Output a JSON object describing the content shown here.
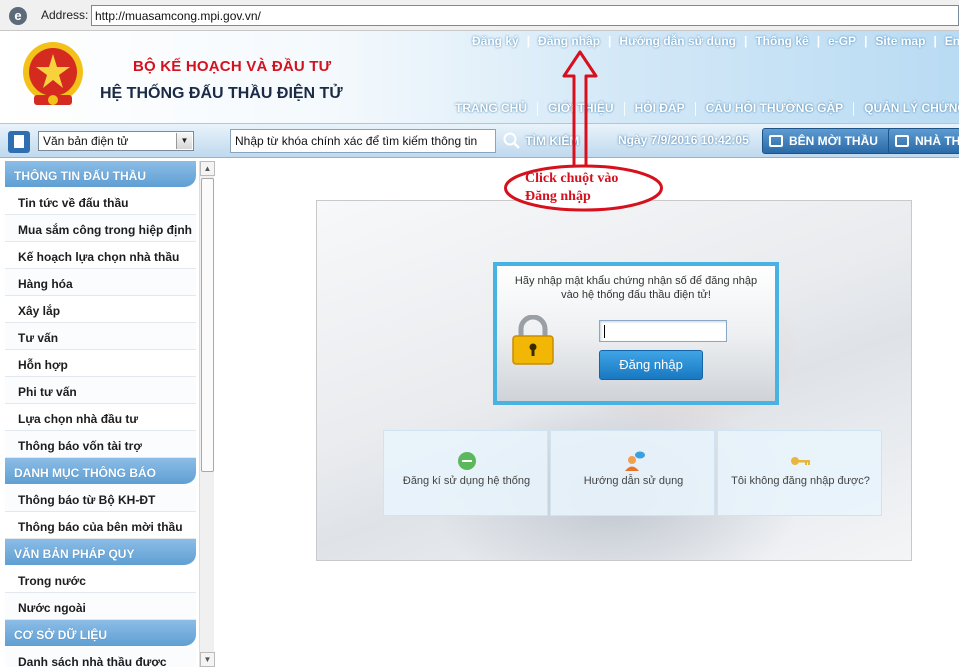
{
  "browser": {
    "address_label": "Address:",
    "url": "http://muasamcong.mpi.gov.vn/"
  },
  "header": {
    "ministry": "BỘ KẾ HOẠCH VÀ ĐẦU TƯ",
    "system_title": "HỆ THỐNG ĐẤU THẦU ĐIỆN TỬ",
    "top_links": [
      "Đăng ký",
      "Đăng nhập",
      "Hướng dẫn sử dụng",
      "Thống kê",
      "e-GP",
      "Site map",
      "Eng"
    ],
    "top_sep": "|",
    "main_nav": [
      "TRANG CHỦ",
      "GIỚI THIỆU",
      "HỎI ĐÁP",
      "CÂU HỎI THƯỜNG GẶP",
      "QUẢN LÝ CHỨNG TH"
    ]
  },
  "toolbar": {
    "category_selected": "Văn bản điện tử",
    "search_placeholder": "Nhập từ khóa chính xác để tìm kiếm thông tin",
    "search_label": "TÌM KIẾM",
    "datetime": "Ngày 7/9/2016 10:42:05",
    "btn_ben_moi_thau": "BÊN MỜI THẦU",
    "btn_nha_thau": "NHÀ TH"
  },
  "sidebar": {
    "sections": [
      {
        "title": "THÔNG TIN ĐẤU THẦU",
        "items": [
          "Tin tức về đấu thầu",
          "Mua sắm công trong hiệp định",
          "Kế hoạch lựa chọn nhà thầu",
          "Hàng hóa",
          "Xây lắp",
          "Tư vấn",
          "Hỗn hợp",
          "Phi tư vấn",
          "Lựa chọn nhà đầu tư",
          "Thông báo vốn tài trợ"
        ]
      },
      {
        "title": "DANH MỤC THÔNG BÁO",
        "items": [
          "Thông báo từ Bộ KH-ĐT",
          "Thông báo của bên mời thầu"
        ]
      },
      {
        "title": "VĂN BẢN PHÁP QUY",
        "items": [
          "Trong nước",
          "Nước ngoài"
        ]
      },
      {
        "title": "CƠ SỞ DỮ LIỆU",
        "items": [
          "Danh sách nhà thầu được"
        ]
      }
    ]
  },
  "login": {
    "message": "Hãy nhập mật khẩu chứng nhận số để đăng nhập vào hệ thống đấu thầu điện tử!",
    "button": "Đăng nhập",
    "options": [
      {
        "label": "Đăng kí sử dụng hệ thống",
        "icon": "register-icon"
      },
      {
        "label": "Hướng dẫn sử dụng",
        "icon": "support-person-icon"
      },
      {
        "label": "Tôi không đăng nhập được?",
        "icon": "keys-icon"
      }
    ]
  },
  "annotation": {
    "line1": "Click chuột vào",
    "line2": "Đăng nhập",
    "color": "#d6101c"
  }
}
